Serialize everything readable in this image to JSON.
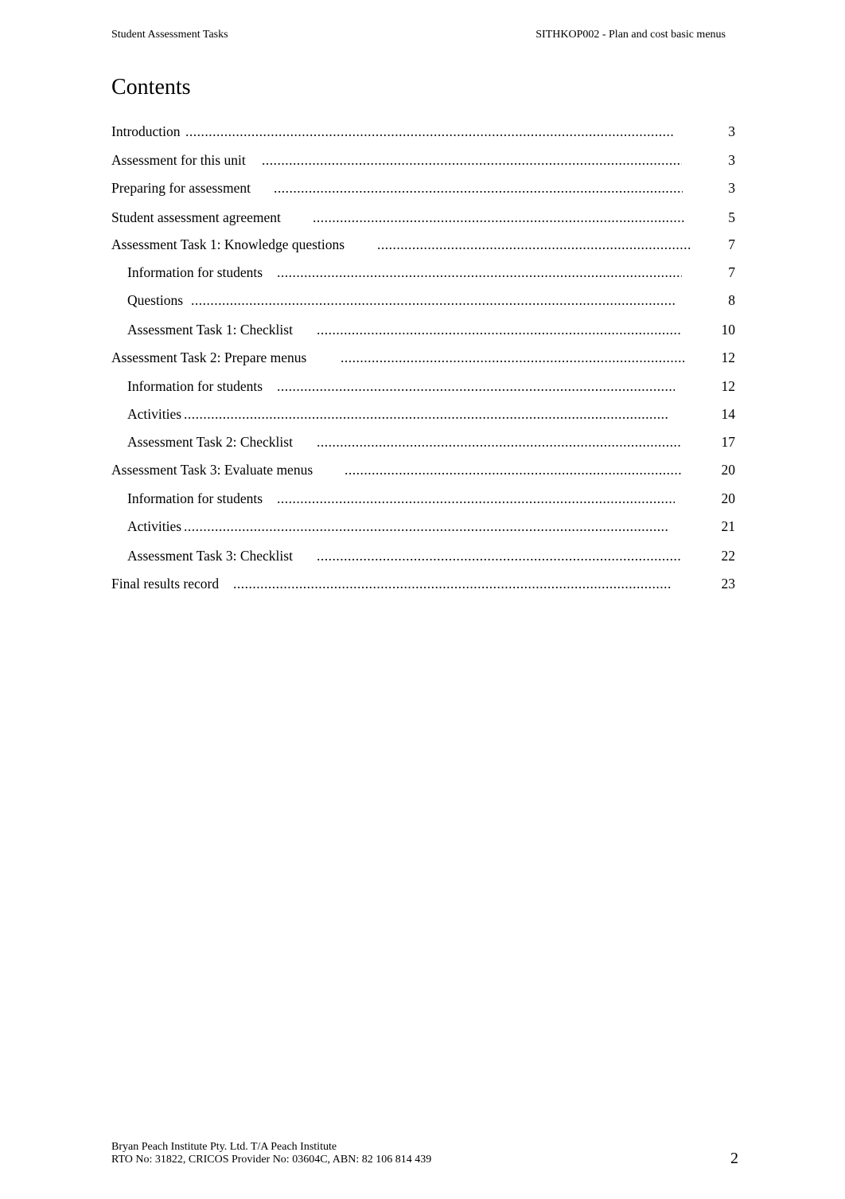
{
  "header": {
    "left": "Student Assessment Tasks",
    "right": "SITHKOP002 - Plan and cost basic menus"
  },
  "title": "Contents",
  "toc": [
    {
      "label": "Introduction",
      "page": "3",
      "level": 1
    },
    {
      "label": "Assessment for this unit",
      "page": "3",
      "level": 1
    },
    {
      "label": "Preparing for assessment",
      "page": "3",
      "level": 1
    },
    {
      "label": "Student assessment agreement",
      "page": "5",
      "level": 1
    },
    {
      "label": "Assessment Task 1: Knowledge questions",
      "page": "7",
      "level": 1
    },
    {
      "label": "Information for students",
      "page": "7",
      "level": 2
    },
    {
      "label": "Questions",
      "page": "8",
      "level": 2
    },
    {
      "label": "Assessment Task 1: Checklist",
      "page": "10",
      "level": 2
    },
    {
      "label": "Assessment Task 2: Prepare menus",
      "page": "12",
      "level": 1
    },
    {
      "label": "Information for students",
      "page": "12",
      "level": 2
    },
    {
      "label": "Activities",
      "page": "14",
      "level": 2
    },
    {
      "label": "Assessment Task 2: Checklist",
      "page": "17",
      "level": 2
    },
    {
      "label": "Assessment Task 3: Evaluate menus",
      "page": "20",
      "level": 1
    },
    {
      "label": "Information for students",
      "page": "20",
      "level": 2
    },
    {
      "label": "Activities",
      "page": "21",
      "level": 2
    },
    {
      "label": "Assessment Task 3: Checklist",
      "page": "22",
      "level": 2
    },
    {
      "label": "Final results record",
      "page": "23",
      "level": 1
    }
  ],
  "footer": {
    "line1": "Bryan Peach Institute Pty. Ltd. T/A Peach Institute",
    "line2": "RTO No: 31822, CRICOS Provider No: 03604C, ABN: 82 106 814 439"
  },
  "page_number": "2"
}
